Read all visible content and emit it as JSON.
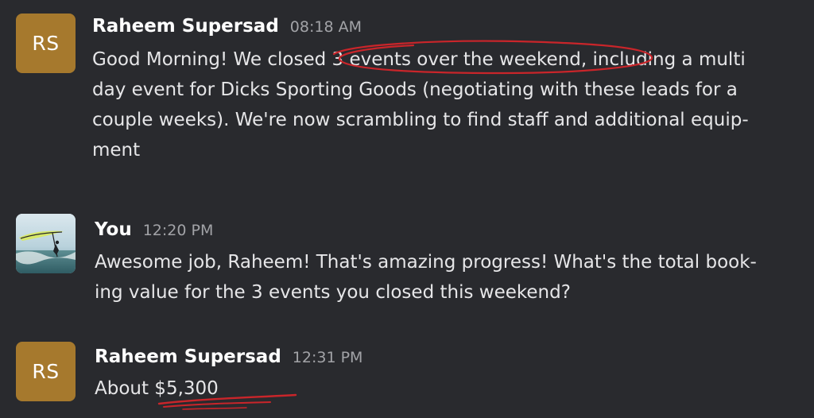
{
  "messages": [
    {
      "sender": "Raheem Supersad",
      "time": "08:18 AM",
      "avatar_initials": "RS",
      "lines": [
        "Good Morning! We closed 3 events over the weekend, including a multi",
        "day event for Dicks Sporting Goods (negotiating with these leads for a",
        "couple weeks). We're now scrambling to find staff and additional equip-",
        "ment"
      ]
    },
    {
      "sender": "You",
      "time": "12:20 PM",
      "avatar_icon": "windsurfer-photo-avatar",
      "lines": [
        "Awesome job, Raheem! That's amazing progress! What's the total book-",
        "ing value for the 3 events you closed this weekend?"
      ]
    },
    {
      "sender": "Raheem Supersad",
      "time": "12:31 PM",
      "avatar_initials": "RS",
      "lines": [
        "About $5,300"
      ]
    }
  ],
  "colors": {
    "background": "#292a2e",
    "avatar_initials_bg": "#a6792d",
    "annotation_red": "#c9252a",
    "timestamp": "#a2a3a7"
  }
}
